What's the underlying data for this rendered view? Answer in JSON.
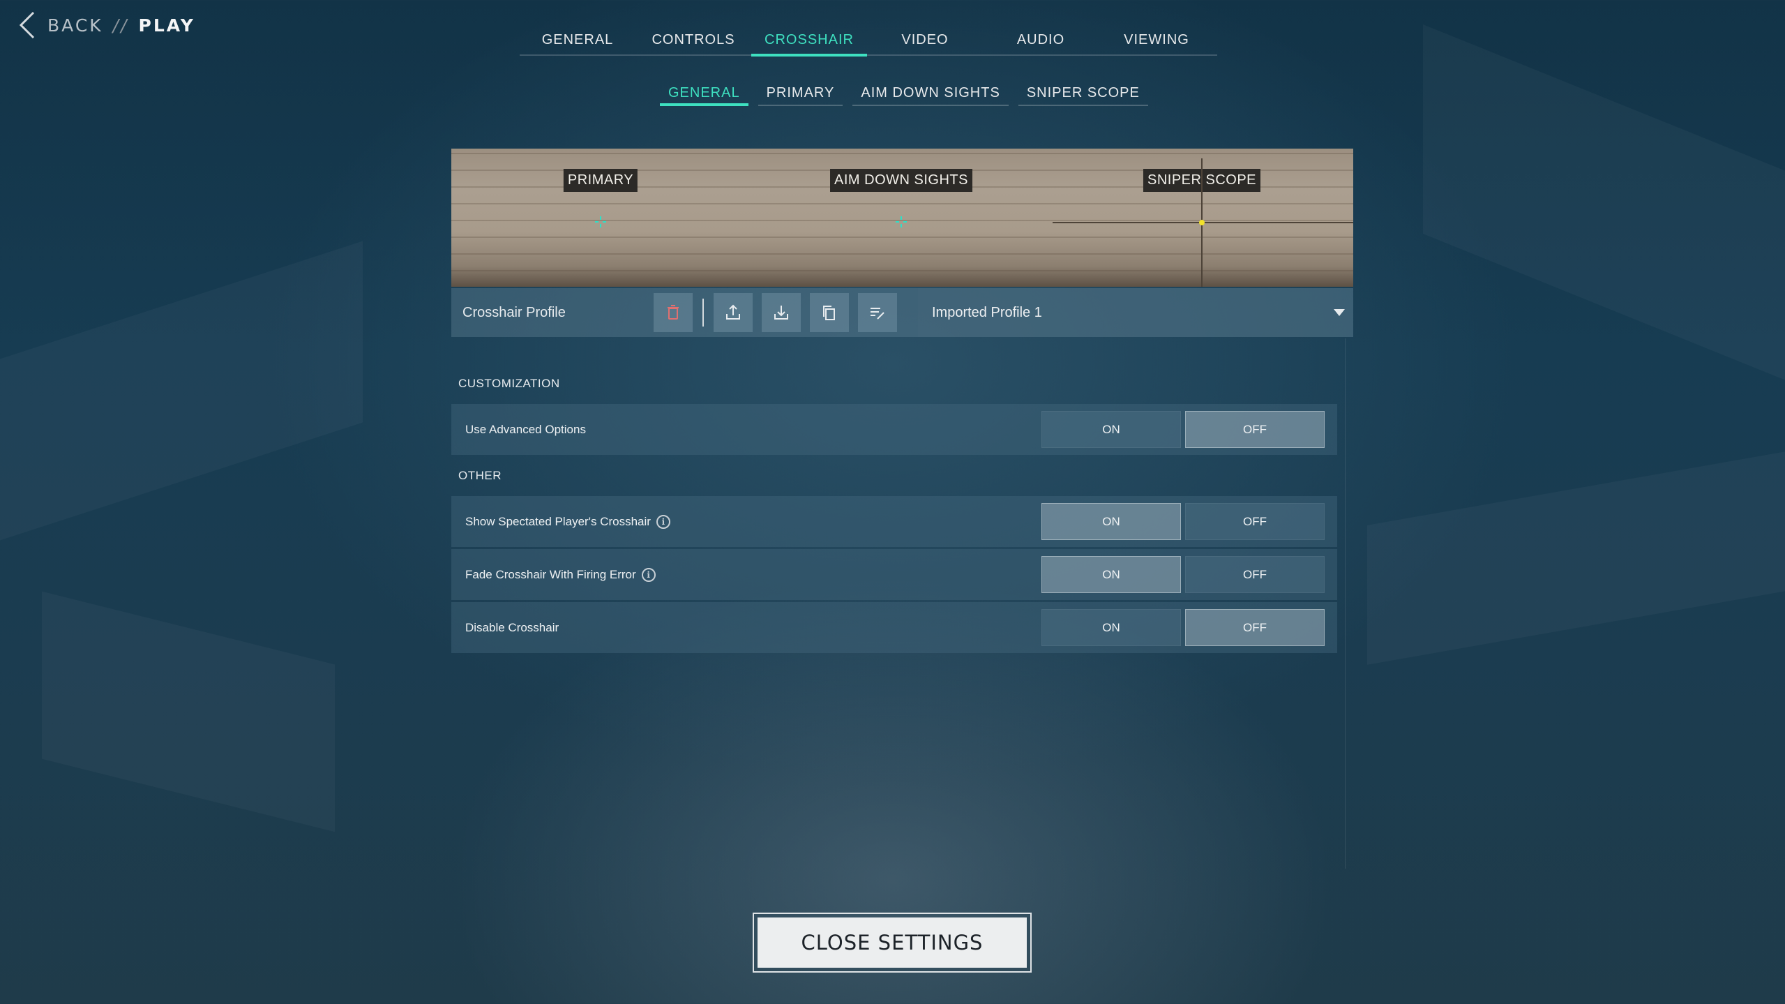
{
  "breadcrumb": {
    "back_label": "BACK",
    "separator": "//",
    "current": "PLAY"
  },
  "top_tabs": [
    {
      "label": "GENERAL",
      "active": false
    },
    {
      "label": "CONTROLS",
      "active": false
    },
    {
      "label": "CROSSHAIR",
      "active": true
    },
    {
      "label": "VIDEO",
      "active": false
    },
    {
      "label": "AUDIO",
      "active": false
    },
    {
      "label": "VIEWING",
      "active": false
    }
  ],
  "sub_tabs": [
    {
      "label": "GENERAL",
      "active": true
    },
    {
      "label": "PRIMARY",
      "active": false
    },
    {
      "label": "AIM DOWN SIGHTS",
      "active": false
    },
    {
      "label": "SNIPER SCOPE",
      "active": false
    }
  ],
  "preview": {
    "primary_label": "PRIMARY",
    "ads_label": "AIM DOWN SIGHTS",
    "scope_label": "SNIPER SCOPE",
    "crosshair_color": "#2fe0c8",
    "scope_dot_color": "#f2e22a"
  },
  "profile": {
    "label": "Crosshair Profile",
    "selected": "Imported Profile 1",
    "actions": [
      "trash-icon",
      "upload-icon",
      "download-icon",
      "copy-icon",
      "rename-icon"
    ]
  },
  "sections": {
    "customization": "CUSTOMIZATION",
    "other": "OTHER"
  },
  "toggle_labels": {
    "on": "ON",
    "off": "OFF"
  },
  "settings": {
    "advanced": {
      "label": "Use Advanced Options",
      "value": "OFF"
    },
    "spectated": {
      "label": "Show Spectated Player's Crosshair",
      "value": "ON",
      "info": "i"
    },
    "fade": {
      "label": "Fade Crosshair With Firing Error",
      "value": "ON",
      "info": "i"
    },
    "disable": {
      "label": "Disable Crosshair",
      "value": "OFF"
    }
  },
  "close_label": "CLOSE SETTINGS",
  "colors": {
    "accent": "#3ee0c0"
  }
}
